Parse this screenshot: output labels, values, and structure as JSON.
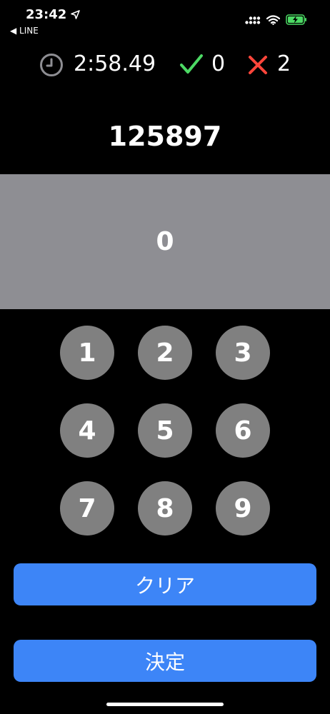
{
  "status_bar": {
    "time": "23:42",
    "back_label": "◀ LINE",
    "battery_color": "#4cd964"
  },
  "stats": {
    "timer": "2:58.49",
    "correct_count": "0",
    "wrong_count": "2",
    "check_color": "#4cd964",
    "cross_color": "#ff453a"
  },
  "target_number": "125897",
  "input_value": "0",
  "keypad": {
    "keys": [
      "1",
      "2",
      "3",
      "4",
      "5",
      "6",
      "7",
      "8",
      "9"
    ]
  },
  "actions": {
    "clear_label": "クリア",
    "submit_label": "決定",
    "accent_color": "#3d85f7"
  }
}
